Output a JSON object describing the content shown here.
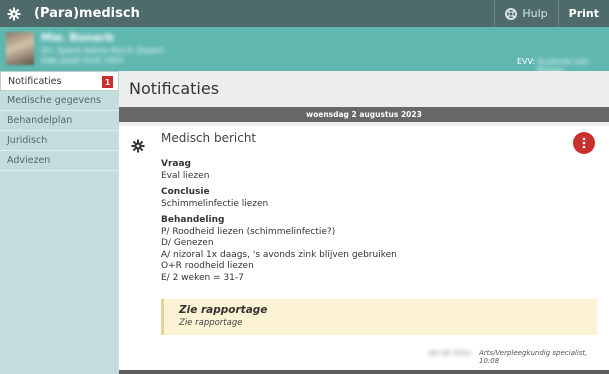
{
  "app": {
    "title": "(Para)medisch",
    "help_label": "Hulp",
    "print_label": "Print"
  },
  "patient": {
    "name": "Mw. Bonarb",
    "line1": "Vri: Speck Kaline Rurch Zeyerh",
    "line2": "Geb.plaat Smit 1955",
    "evv_label": "EVV:",
    "evv_value": "Suzanne van Rooien"
  },
  "sidebar": {
    "items": [
      {
        "label": "Notificaties",
        "badge": "1",
        "active": true
      },
      {
        "label": "Medische gegevens"
      },
      {
        "label": "Behandelplan"
      },
      {
        "label": "Juridisch"
      },
      {
        "label": "Adviezen"
      }
    ]
  },
  "main": {
    "title": "Notificaties",
    "date": "woensdag 2 augustus 2023",
    "card": {
      "title": "Medisch bericht",
      "vraag_label": "Vraag",
      "vraag": "Eval liezen",
      "conclusie_label": "Conclusie",
      "conclusie": "Schimmelinfectie liezen",
      "behandeling_label": "Behandeling",
      "behandeling_lines": [
        "P/ Roodheid liezen (schimmelinfectie?)",
        "D/ Genezen",
        "A/ nizoral 1x daags, 's avonds zink blijven gebruiken",
        "O+R roodheid liezen",
        "E/ 2 weken = 31-7"
      ],
      "note_title": "Zie rapportage",
      "note_text": "Zie rapportage",
      "author_name": "Jan de Vries",
      "author_role": "Arts/Verpleegkundig specialist, 10:08"
    }
  },
  "colors": {
    "topbar": "#4f6a6a",
    "patientbar": "#5fb7b0",
    "sidebar": "#c3dcdc",
    "accent_red": "#c9302c",
    "note_bg": "#fbf3d4"
  }
}
